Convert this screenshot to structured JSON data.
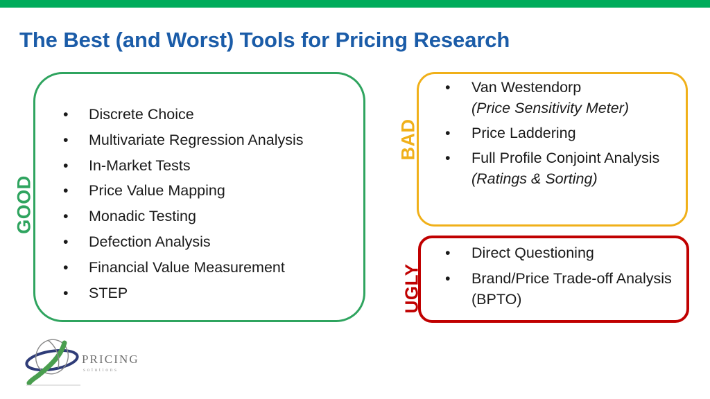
{
  "slide": {
    "title": "The Best (and Worst) Tools for Pricing Research",
    "accent_bar_color": "#00AC5B",
    "title_color": "#1B5CA8"
  },
  "categories": {
    "good": {
      "label": "GOOD",
      "color": "#2FA45F",
      "items": [
        {
          "text": "Discrete Choice"
        },
        {
          "text": "Multivariate Regression Analysis"
        },
        {
          "text": "In-Market Tests"
        },
        {
          "text": "Price Value Mapping"
        },
        {
          "text": "Monadic Testing"
        },
        {
          "text": "Defection Analysis"
        },
        {
          "text": "Financial Value Measurement"
        },
        {
          "text": "STEP"
        }
      ]
    },
    "bad": {
      "label": "BAD",
      "color": "#F0B019",
      "items": [
        {
          "text": "Van Westendorp",
          "sub": "(Price Sensitivity Meter)"
        },
        {
          "text": "Price Laddering"
        },
        {
          "text": "Full Profile Conjoint Analysis",
          "sub": "(Ratings & Sorting)"
        }
      ]
    },
    "ugly": {
      "label": "UGLY",
      "color": "#C00000",
      "items": [
        {
          "text": "Direct Questioning"
        },
        {
          "text": "Brand/Price Trade-off Analysis (BPTO)"
        }
      ]
    }
  },
  "logo": {
    "word": "PRICING",
    "sub": "solutions",
    "swoosh_color": "#4A9E4F",
    "ellipse_color": "#2F3C78"
  },
  "bullet_glyph": "•"
}
